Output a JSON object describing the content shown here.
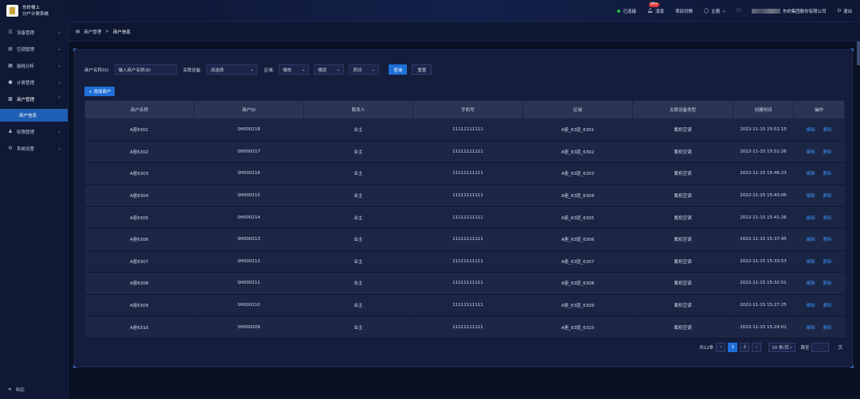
{
  "app": {
    "title_line1": "东岭楼上",
    "title_line2": "分户计费系统"
  },
  "topbar": {
    "status": "已连接",
    "message_label": "消息",
    "message_badge": "99+",
    "project_switch": "项目切换",
    "theme": "主题",
    "company": "东岭集团股份有限公司",
    "logout": "退出"
  },
  "sidebar": {
    "items": [
      {
        "label": "设备管理",
        "icon": "device-icon"
      },
      {
        "label": "空调管理",
        "icon": "aircon-icon"
      },
      {
        "label": "能耗分析",
        "icon": "chart-icon"
      },
      {
        "label": "计费管理",
        "icon": "billing-icon"
      },
      {
        "label": "商户管理",
        "icon": "merchant-icon"
      },
      {
        "label": "权限管理",
        "icon": "users-icon"
      },
      {
        "label": "系统设置",
        "icon": "settings-icon"
      }
    ],
    "active_sub": "商户信息",
    "collapse": "收起"
  },
  "breadcrumb": {
    "parent": "商户管理",
    "sep": ">",
    "current": "商户信息"
  },
  "filters": {
    "name_label": "商户名称/ID:",
    "name_placeholder": "输入商户名称/ID",
    "device_label": "关联设备:",
    "device_value": "请选择",
    "area_label": "区域:",
    "building": "楼栋",
    "floor": "楼层",
    "room": "房间",
    "query": "查询",
    "reset": "重置"
  },
  "add_button": "+ 添加商户",
  "table": {
    "headers": [
      "商户名称",
      "商户ID",
      "联系人",
      "手机号",
      "区域",
      "关联设备类型",
      "创建时间",
      "操作"
    ],
    "rows": [
      [
        "A座6301",
        "SH000218",
        "业主",
        "11111111111",
        "A座_63层_6301",
        "氟机空调",
        "2022-11-15 15:52:15"
      ],
      [
        "A座6302",
        "SH000217",
        "业主",
        "11111111111",
        "A座_63层_6302",
        "氟机空调",
        "2022-11-15 15:51:26"
      ],
      [
        "A座6303",
        "SH000216",
        "业主",
        "11111111111",
        "A座_63层_6303",
        "氟机空调",
        "2022-11-15 15:46:23"
      ],
      [
        "A座6304",
        "SH000215",
        "业主",
        "11111111111",
        "A座_63层_6304",
        "氟机空调",
        "2022-11-15 15:43:06"
      ],
      [
        "A座6305",
        "SH000214",
        "业主",
        "11111111111",
        "A座_63层_6305",
        "氟机空调",
        "2022-11-15 15:41:26"
      ],
      [
        "A座6306",
        "SH000213",
        "业主",
        "11111111111",
        "A座_63层_6306",
        "氟机空调",
        "2022-11-15 15:37:45"
      ],
      [
        "A座6307",
        "SH000212",
        "业主",
        "11111111111",
        "A座_63层_6307",
        "氟机空调",
        "2022-11-15 15:33:53"
      ],
      [
        "A座6308",
        "SH000211",
        "业主",
        "11111111111",
        "A座_63层_6308",
        "氟机空调",
        "2022-11-15 15:32:51"
      ],
      [
        "A座6309",
        "SH000210",
        "业主",
        "11111111111",
        "A座_63层_6309",
        "氟机空调",
        "2022-11-15 15:27:25"
      ],
      [
        "A座6310",
        "SH000209",
        "业主",
        "11111111111",
        "A座_63层_6310",
        "氟机空调",
        "2022-11-15 15:24:01"
      ]
    ],
    "edit": "编辑",
    "delete": "删除"
  },
  "pager": {
    "total": "共12条",
    "page1": "1",
    "page2": "2",
    "size": "10 条/页",
    "goto": "跳至",
    "page_unit": "页"
  },
  "colors": {
    "accent": "#1e6fd8",
    "bg": "#0b1124",
    "panel": "#141d3b"
  }
}
